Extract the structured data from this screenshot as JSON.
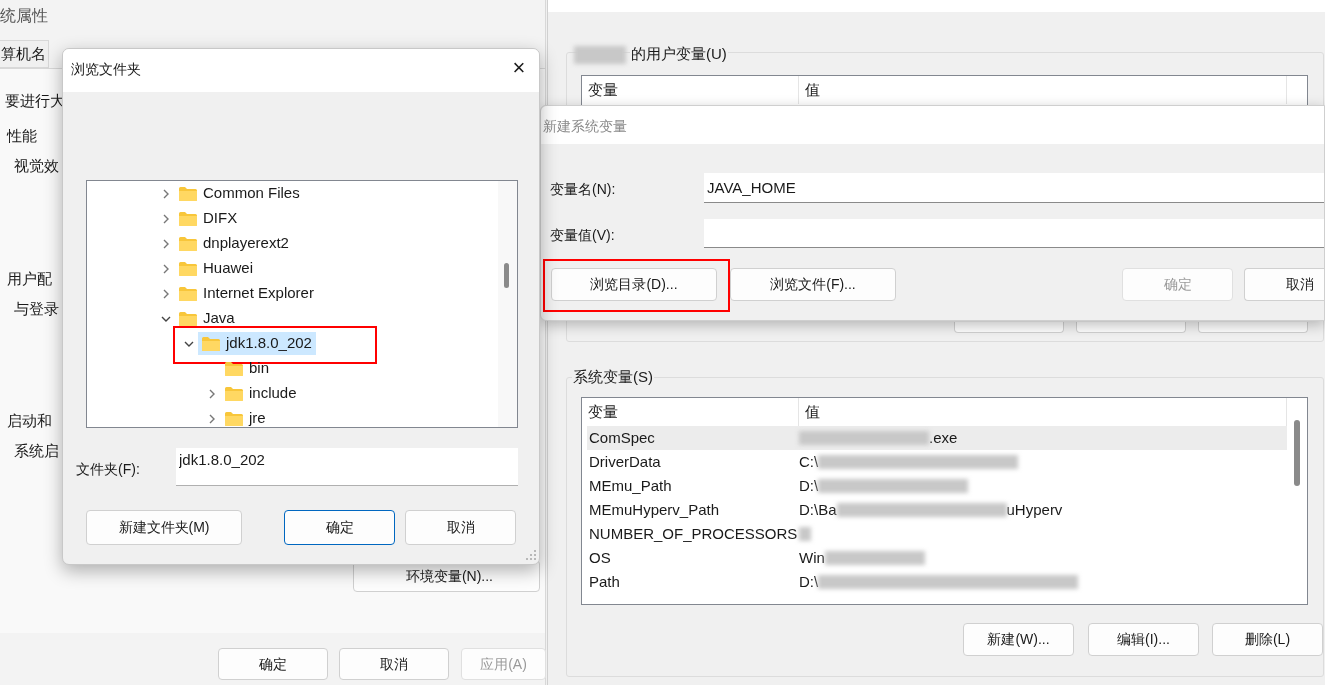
{
  "system_properties": {
    "title": "统属性",
    "tabs": [
      {
        "label": "算机名",
        "selected": false
      }
    ],
    "texts": [
      {
        "kind": "line",
        "text": "要进行大"
      },
      {
        "kind": "group",
        "text": "性能"
      },
      {
        "kind": "item",
        "text": "视觉效"
      },
      {
        "kind": "group",
        "text": "用户配"
      },
      {
        "kind": "item",
        "text": "与登录"
      },
      {
        "kind": "group",
        "text": "启动和"
      },
      {
        "kind": "item",
        "text": "系统启"
      }
    ],
    "env_button": "环境变量(N)...",
    "buttons": [
      {
        "label": "确定",
        "disabled": false
      },
      {
        "label": "取消",
        "disabled": false
      },
      {
        "label": "应用(A)",
        "disabled": true
      }
    ]
  },
  "environment_variables": {
    "user_group": "的用户变量(U)",
    "user_columns": [
      "变量",
      "值"
    ],
    "system_group": "系统变量(S)",
    "system_columns": [
      "变量",
      "值"
    ],
    "system_rows": [
      {
        "name": "ComSpec",
        "tail": ".exe",
        "selected": true
      },
      {
        "name": "DriverData",
        "lead": "C:\\",
        "selected": false
      },
      {
        "name": "MEmu_Path",
        "lead": "D:\\",
        "selected": false
      },
      {
        "name": "MEmuHyperv_Path",
        "lead": "D:\\Ba",
        "tail": "uHyperv",
        "selected": false
      },
      {
        "name": "NUMBER_OF_PROCESSORS",
        "selected": false
      },
      {
        "name": "OS",
        "lead": "Win",
        "selected": false
      },
      {
        "name": "Path",
        "lead": "D:\\",
        "selected": false
      }
    ],
    "system_buttons": [
      "新建(W)...",
      "编辑(I)...",
      "删除(L)"
    ]
  },
  "new_variable_dialog": {
    "title": "新建系统变量",
    "name_label": "变量名(N):",
    "name_value": "JAVA_HOME",
    "value_label": "变量值(V):",
    "buttons": [
      {
        "label": "浏览目录(D)...",
        "disabled": false,
        "highlighted": true
      },
      {
        "label": "浏览文件(F)...",
        "disabled": false
      },
      {
        "label": "确定",
        "disabled": true
      },
      {
        "label": "取消",
        "disabled": false
      }
    ]
  },
  "browse_dialog": {
    "title": "浏览文件夹",
    "close": "×",
    "tree": [
      {
        "label": "Common Files",
        "expanded": false,
        "selected": false
      },
      {
        "label": "DIFX",
        "expanded": false,
        "selected": false
      },
      {
        "label": "dnplayerext2",
        "expanded": false,
        "selected": false
      },
      {
        "label": "Huawei",
        "expanded": false,
        "selected": false
      },
      {
        "label": "Internet Explorer",
        "expanded": false,
        "selected": false
      },
      {
        "label": "Java",
        "expanded": true,
        "selected": false,
        "children": [
          {
            "label": "jdk1.8.0_202",
            "expanded": true,
            "selected": true,
            "highlighted": true,
            "children": [
              {
                "label": "bin",
                "selected": false
              },
              {
                "label": "include",
                "expanded": false,
                "selected": false
              },
              {
                "label": "jre",
                "expanded": false,
                "selected": false
              }
            ]
          }
        ]
      }
    ],
    "folder_label": "文件夹(F):",
    "folder_value": "jdk1.8.0_202",
    "buttons": [
      {
        "label": "新建文件夹(M)",
        "default": false
      },
      {
        "label": "确定",
        "default": true
      },
      {
        "label": "取消",
        "default": false
      }
    ]
  }
}
